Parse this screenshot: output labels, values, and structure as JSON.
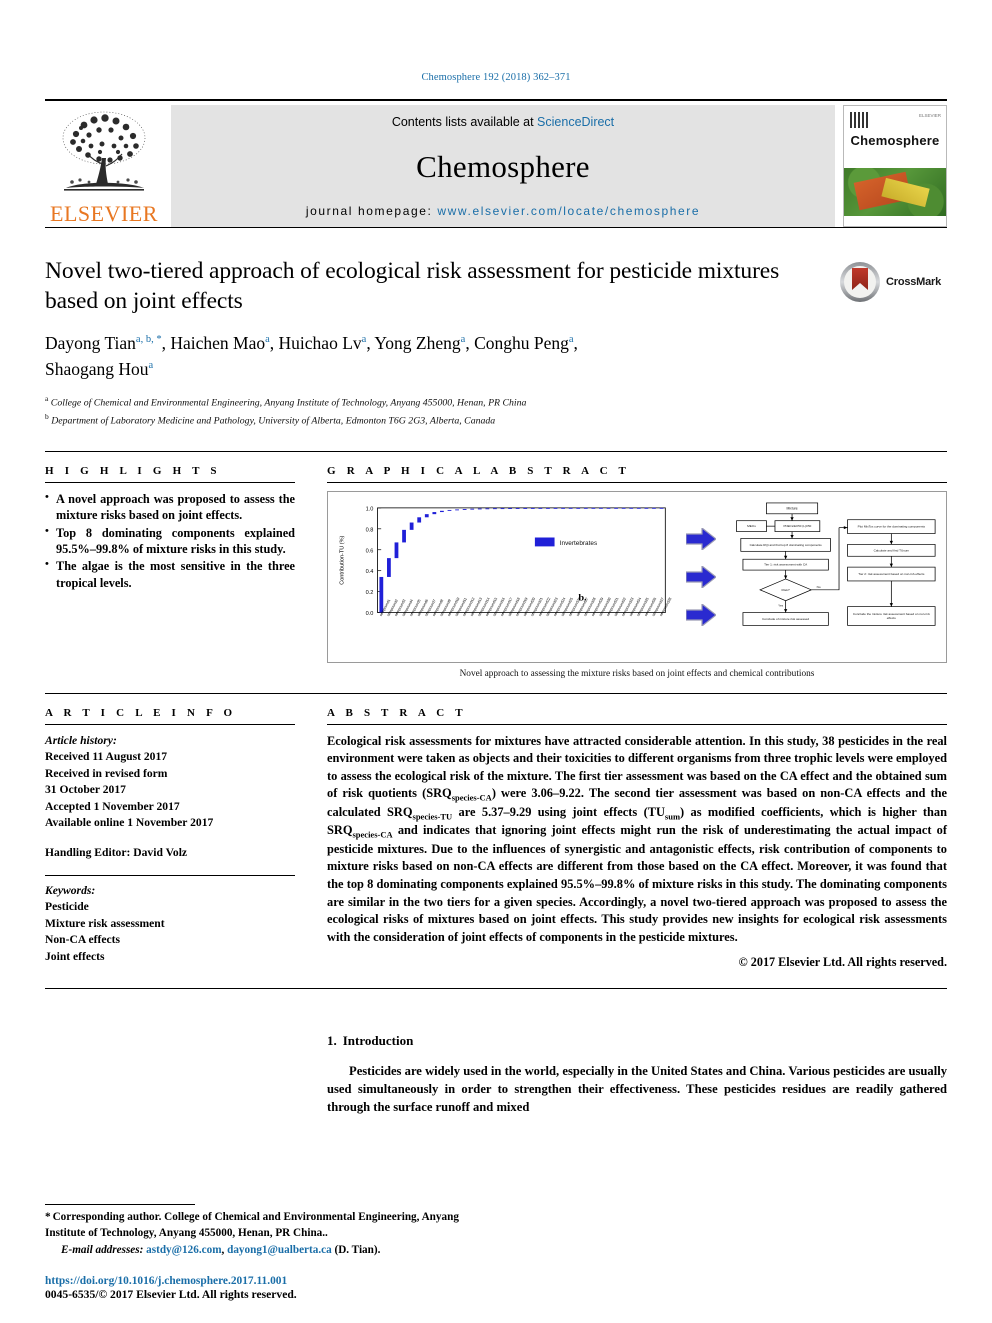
{
  "running_head": "Chemosphere 192 (2018) 362–371",
  "masthead": {
    "contents_prefix": "Contents lists available at ",
    "contents_link": "ScienceDirect",
    "journal_name": "Chemosphere",
    "homepage_prefix": "journal homepage: ",
    "homepage_url": "www.elsevier.com/locate/chemosphere",
    "publisher": "ELSEVIER",
    "cover_title": "Chemosphere",
    "cover_publisher": "ELSEVIER"
  },
  "article": {
    "title": "Novel two-tiered approach of ecological risk assessment for pesticide mixtures based on joint effects",
    "crossmark_label": "CrossMark",
    "authors_line1_parts": [
      {
        "name": "Dayong Tian",
        "sup": "a, b, *"
      },
      {
        "name": "Haichen Mao",
        "sup": "a"
      },
      {
        "name": "Huichao Lv",
        "sup": "a"
      },
      {
        "name": "Yong Zheng",
        "sup": "a"
      },
      {
        "name": "Conghu Peng",
        "sup": "a"
      }
    ],
    "authors_line2": {
      "name": "Shaogang Hou",
      "sup": "a"
    },
    "affiliations": [
      {
        "sup": "a",
        "text": "College of Chemical and Environmental Engineering, Anyang Institute of Technology, Anyang 455000, Henan, PR China"
      },
      {
        "sup": "b",
        "text": "Department of Laboratory Medicine and Pathology, University of Alberta, Edmonton T6G 2G3, Alberta, Canada"
      }
    ]
  },
  "highlights": {
    "heading": "H I G H L I G H T S",
    "items": [
      "A novel approach was proposed to assess the mixture risks based on joint effects.",
      "Top 8 dominating components explained 95.5%–99.8% of mixture risks in this study.",
      "The algae is the most sensitive in the three tropical levels."
    ]
  },
  "graphical_abstract": {
    "heading": "G R A P H I C A L   A B S T R A C T",
    "caption": "Novel approach to assessing the mixture risks based on joint effects and chemical contributions",
    "panel_label": "b.",
    "legend_label": "Invertebrates",
    "flow_nodes": [
      "Mixture",
      "MECs",
      "PNECs/EC50 (L)C50",
      "Calculate RQi and find top 8 dominating components",
      "Tier 1: risk assessment with CA",
      "Risk?",
      "Conclude of mixture risk assessed",
      "Plot MixTox curve for the dominating components",
      "Calculate and find TUsum",
      "Tier 2: risk assessment based on non-CA effects",
      "Conclude the mixture risk assessment based on non-CA effects"
    ],
    "flow_branch_yes": "Yes",
    "flow_branch_no": "No"
  },
  "chart_data": {
    "type": "bar",
    "title": "",
    "xlabel": "",
    "ylabel": "Contribution-TU (%)",
    "ylim": [
      0,
      1.0
    ],
    "yticks": [
      "0.0",
      "0.2",
      "0.4",
      "0.6",
      "0.8",
      "1.0"
    ],
    "legend": [
      "Invertebrates"
    ],
    "legend_position": "upper-right",
    "grid": false,
    "series_color": "#2020d8",
    "categories": [
      "c1",
      "c2",
      "c3",
      "c4",
      "c5",
      "c6",
      "c7",
      "c8",
      "c9",
      "c10",
      "c11",
      "c12",
      "c13",
      "c14",
      "c15",
      "c16",
      "c17",
      "c18",
      "c19",
      "c20",
      "c21",
      "c22",
      "c23",
      "c24",
      "c25",
      "c26",
      "c27",
      "c28",
      "c29",
      "c30",
      "c31",
      "c32",
      "c33",
      "c34",
      "c35",
      "c36",
      "c37",
      "c38"
    ],
    "cumulative_values": [
      0.34,
      0.52,
      0.67,
      0.79,
      0.86,
      0.91,
      0.94,
      0.96,
      0.972,
      0.98,
      0.985,
      0.989,
      0.992,
      0.994,
      0.9955,
      0.9965,
      0.9972,
      0.9978,
      0.9983,
      0.9987,
      0.999,
      0.9992,
      0.9994,
      0.9995,
      0.9996,
      0.9997,
      0.99975,
      0.9998,
      0.99985,
      0.9999,
      0.99992,
      0.99994,
      0.99996,
      0.99997,
      0.99998,
      0.99999,
      0.999995,
      1.0
    ]
  },
  "article_info": {
    "heading": "A R T I C L E   I N F O",
    "history_label": "Article history:",
    "history": [
      "Received 11 August 2017",
      "Received in revised form",
      "31 October 2017",
      "Accepted 1 November 2017",
      "Available online 1 November 2017"
    ],
    "handling_editor": "Handling Editor: David Volz",
    "keywords_label": "Keywords:",
    "keywords": [
      "Pesticide",
      "Mixture risk assessment",
      "Non-CA effects",
      "Joint effects"
    ]
  },
  "abstract": {
    "heading": "A B S T R A C T",
    "paragraph_1": "Ecological risk assessments for mixtures have attracted considerable attention. In this study, 38 pesticides in the real environment were taken as objects and their toxicities to different organisms from three trophic levels were employed to assess the ecological risk of the mixture. The first tier assessment was based on the CA effect and the obtained sum of risk quotients (SRQ",
    "sub_1": "species-CA",
    "paragraph_2": ") were 3.06–9.22. The second tier assessment was based on non-CA effects and the calculated SRQ",
    "sub_2": "species-TU",
    "paragraph_3": " are 5.37–9.29 using joint effects (TU",
    "sub_3": "sum",
    "paragraph_4": ") as modified coefficients, which is higher than SRQ",
    "sub_4": "species-CA",
    "paragraph_5": " and indicates that ignoring joint effects might run the risk of underestimating the actual impact of pesticide mixtures. Due to the influences of synergistic and antagonistic effects, risk contribution of components to mixture risks based on non-CA effects are different from those based on the CA effect. Moreover, it was found that the top 8 dominating components explained 95.5%–99.8% of mixture risks in this study. The dominating components are similar in the two tiers for a given species. Accordingly, a novel two-tiered approach was proposed to assess the ecological risks of mixtures based on joint effects. This study provides new insights for ecological risk assessments with the consideration of joint effects of components in the pesticide mixtures.",
    "copyright": "© 2017 Elsevier Ltd. All rights reserved."
  },
  "introduction": {
    "number": "1.",
    "heading": "Introduction",
    "paragraph": "Pesticides are widely used in the world, especially in the United States and China. Various pesticides are usually used simultaneously in order to strengthen their effectiveness. These pesticides residues are readily gathered through the surface runoff and mixed"
  },
  "footer": {
    "corresponding_star": "*",
    "corresponding_text": "Corresponding author. College of Chemical and Environmental Engineering, Anyang Institute of Technology, Anyang 455000, Henan, PR China..",
    "email_label": "E-mail addresses:",
    "email_1": "astdy@126.com",
    "email_separator": ", ",
    "email_2": "dayong1@ualberta.ca",
    "email_suffix": " (D. Tian).",
    "doi": "https://doi.org/10.1016/j.chemosphere.2017.11.001",
    "issn": "0045-6535/© 2017 Elsevier Ltd. All rights reserved."
  },
  "colors": {
    "link_blue": "#1a6ea8",
    "elsevier_orange": "#E87722",
    "masthead_gray": "#e3e3e3",
    "chart_blue": "#2020d8",
    "arrow_blue": "#2a2ad0"
  }
}
